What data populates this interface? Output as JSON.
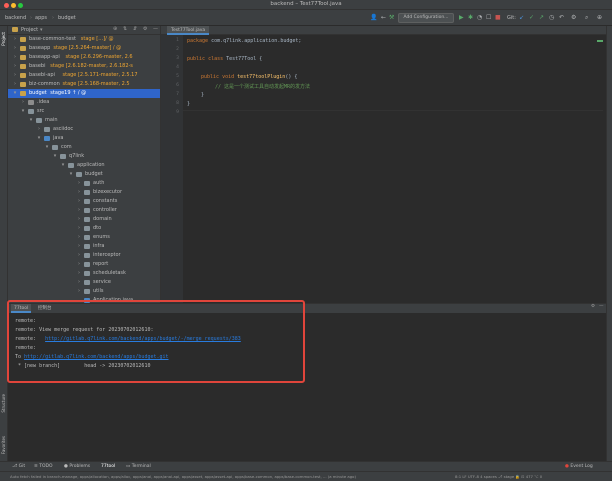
{
  "window": {
    "title": "backend – Test77Tool.java"
  },
  "navbar": {
    "crumbs": [
      "backend",
      "apps",
      "budget"
    ],
    "add_configuration": "Add Configuration...",
    "git_label": "Git:"
  },
  "sidebar": {
    "project_tab": "Project",
    "structure_tab": "Structure",
    "favorites_tab": "Favorites"
  },
  "project": {
    "header": "Project",
    "rows": [
      {
        "label": "base-common-test",
        "hint": "stage […]/ @"
      },
      {
        "label": "baseapp",
        "hint": "stage [2.5.264-master] / @"
      },
      {
        "label": "baseapp-api",
        "hint": "stage [2.6.296-master, 2.6"
      },
      {
        "label": "basebi",
        "hint": "stage [2.6.182-master, 2.6.182-s"
      },
      {
        "label": "basebi-api",
        "hint": "stage [2.5.171-master, 2.5.17"
      },
      {
        "label": "biz-common",
        "hint": "stage [2.5.168-master, 2.5"
      },
      {
        "label": "budget",
        "hint": "stage19 ↑ / @"
      },
      {
        "label": ".idea",
        "hint": ""
      },
      {
        "label": "src",
        "hint": ""
      },
      {
        "label": "main",
        "hint": ""
      },
      {
        "label": "asciidoc",
        "hint": ""
      },
      {
        "label": "java",
        "hint": ""
      },
      {
        "label": "com",
        "hint": ""
      },
      {
        "label": "q7link",
        "hint": ""
      },
      {
        "label": "application",
        "hint": ""
      },
      {
        "label": "budget",
        "hint": ""
      },
      {
        "label": "auth",
        "hint": ""
      },
      {
        "label": "bizexecutor",
        "hint": ""
      },
      {
        "label": "constants",
        "hint": ""
      },
      {
        "label": "controller",
        "hint": ""
      },
      {
        "label": "domain",
        "hint": ""
      },
      {
        "label": "dto",
        "hint": ""
      },
      {
        "label": "enums",
        "hint": ""
      },
      {
        "label": "infra",
        "hint": ""
      },
      {
        "label": "interceptor",
        "hint": ""
      },
      {
        "label": "report",
        "hint": ""
      },
      {
        "label": "scheduletask",
        "hint": ""
      },
      {
        "label": "service",
        "hint": ""
      },
      {
        "label": "utils",
        "hint": ""
      },
      {
        "label": "Application.java",
        "hint": ""
      }
    ]
  },
  "editor": {
    "tab": "Test77Tool.java",
    "line_numbers": [
      "1",
      "2",
      "3",
      "4",
      "5",
      "6",
      "7",
      "8",
      "9"
    ],
    "lines": {
      "l1_kw": "package",
      "l1_rest": " com.q7link.application.budget;",
      "l3_kw": "public class",
      "l3_rest": " Test77Tool {",
      "l5_kw": "public void",
      "l5_fn": " test77toolPlugin",
      "l5_rest": "() {",
      "l6": "// 这是一个测试工具自动发起MR的发方法",
      "l7": "}",
      "l8": "}"
    }
  },
  "bottom": {
    "tabs": [
      "77tool",
      "控制台"
    ],
    "lines": {
      "o1": "remote:",
      "o2": "remote: View merge request for 20230702012610:",
      "o3_pre": "remote:   ",
      "o3_link": "http://gitlab.q7link.com/backend/apps/budget/-/merge_requests/383",
      "o4": "remote:",
      "o5_pre": "To ",
      "o5_link": "http://gitlab.q7link.com/backend/apps/budget.git",
      "o6": " * [new branch]        head -> 20230702012610"
    }
  },
  "toolbar_bottom": {
    "items": [
      "Git",
      "TODO",
      "Problems",
      "77tool",
      "Terminal"
    ],
    "event_log": "Event Log"
  },
  "status": {
    "message": "Auto fetch failed in branch-manage, apps/allocation, apps/alloc, apps/anal, apps/anal-api, apps/asset, apps/asset-api, apps/base-common, apps/base-common-test, ... (a minute ago)",
    "right": "8:1   LF   UTF-8   4 spaces   ⎇ stage   🔒   ⊡ 477 ⌥ 0"
  },
  "colors": {
    "accent": "#2f65ca",
    "highlight_box": "#e0453b",
    "link": "#287bde"
  }
}
